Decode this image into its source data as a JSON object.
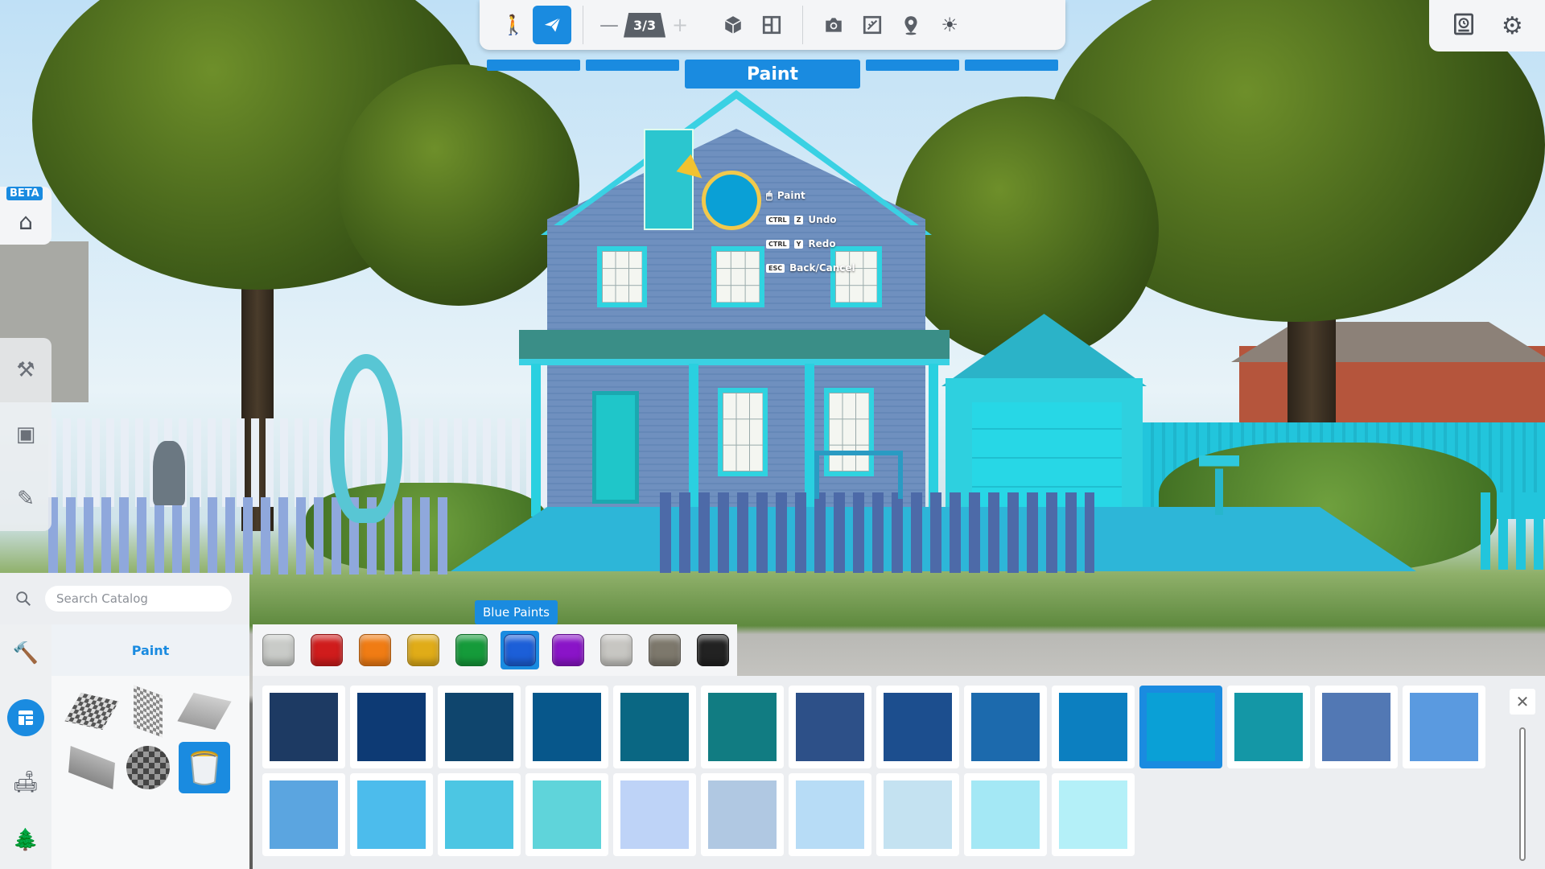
{
  "toolbar": {
    "floor_indicator": "3/3",
    "minus": "—",
    "plus": "+"
  },
  "mode": {
    "title": "Paint"
  },
  "left": {
    "beta_badge": "BETA"
  },
  "hints": [
    {
      "keys": [],
      "label": "Paint"
    },
    {
      "keys": [
        "CTRL",
        "Z"
      ],
      "label": "Undo"
    },
    {
      "keys": [
        "CTRL",
        "Y"
      ],
      "label": "Redo"
    },
    {
      "keys": [
        "ESC"
      ],
      "label": "Back/Cancel"
    }
  ],
  "search": {
    "placeholder": "Search Catalog"
  },
  "catalog": {
    "title": "Paint"
  },
  "families": {
    "tooltip": "Blue Paints",
    "colors": [
      "#c9cbc8",
      "#d01c1c",
      "#f07c14",
      "#e0ac18",
      "#159b3a",
      "#1c5fd8",
      "#8a14c8",
      "#c7c6c2",
      "#7d786c",
      "#222222"
    ],
    "selected_index": 5
  },
  "swatches": {
    "colors": [
      "#1d3a63",
      "#0d3a74",
      "#0f456d",
      "#07578b",
      "#0a6783",
      "#117c82",
      "#2d5088",
      "#1c4e8e",
      "#1c6aad",
      "#0c7fc0",
      "#0aa0d6",
      "#1497a6",
      "#5278b4",
      "#5a9ae0",
      "#5ba5e0",
      "#4cbcec",
      "#4cc6e3",
      "#5fd4da",
      "#bed3f7",
      "#b0c8e2",
      "#b7dcf6",
      "#c4e2f1",
      "#a4e8f5",
      "#b4f0f8"
    ],
    "selected_index": 10
  }
}
